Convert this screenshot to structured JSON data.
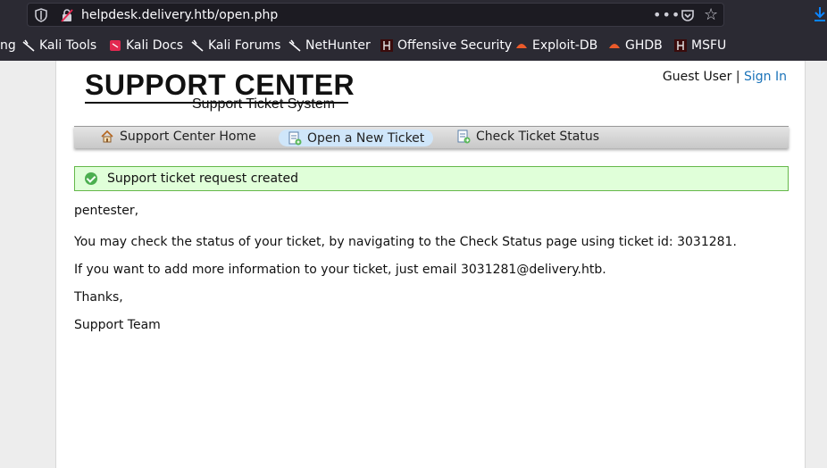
{
  "browser": {
    "url": "helpdesk.delivery.htb/open.php"
  },
  "bookmarks": [
    {
      "label": "ng"
    },
    {
      "label": "Kali Tools"
    },
    {
      "label": "Kali Docs"
    },
    {
      "label": "Kali Forums"
    },
    {
      "label": "NetHunter"
    },
    {
      "label": "Offensive Security"
    },
    {
      "label": "Exploit-DB"
    },
    {
      "label": "GHDB"
    },
    {
      "label": "MSFU"
    }
  ],
  "header": {
    "logo_title": "SUPPORT CENTER",
    "logo_subtitle": "Support Ticket System",
    "user": "Guest User |",
    "sign_in": "Sign In"
  },
  "nav": {
    "home": "Support Center Home",
    "open": "Open a New Ticket",
    "status": "Check Ticket Status"
  },
  "notice": {
    "text": "Support ticket request created"
  },
  "message": {
    "greeting": "pentester,",
    "line1": "You may check the status of your ticket, by navigating to the Check Status page using ticket id: 3031281.",
    "line2": "If you want to add more information to your ticket, just email 3031281@delivery.htb.",
    "thanks": "Thanks,",
    "signature": "Support Team"
  },
  "colors": {
    "link": "#1a73b9",
    "notice_bg": "#e0ffd9",
    "notice_border": "#65b84a"
  }
}
